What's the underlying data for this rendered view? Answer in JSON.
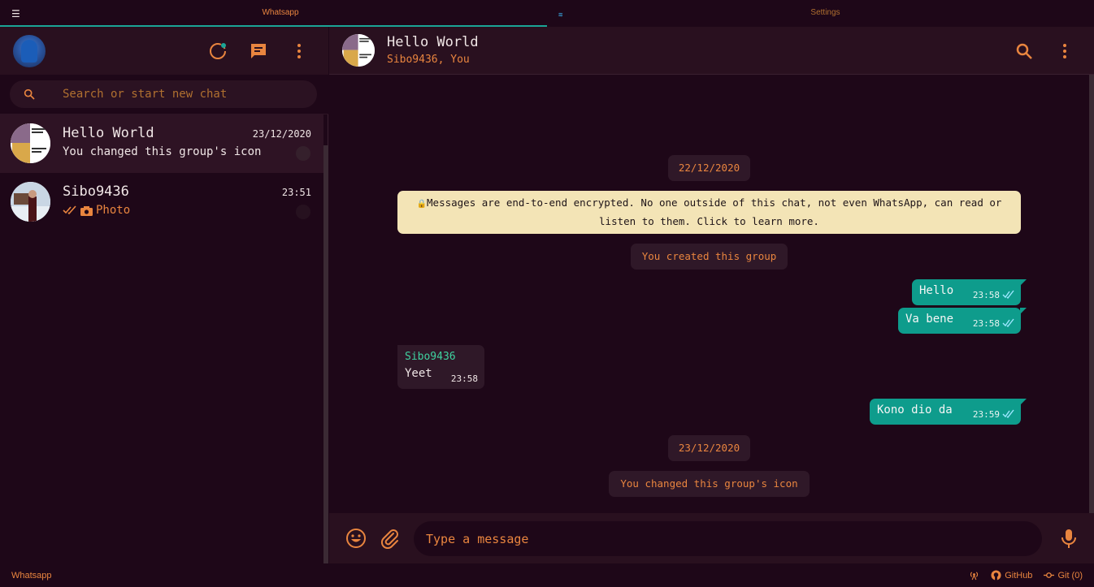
{
  "tabs": {
    "whatsapp": "Whatsapp",
    "settings": "Settings"
  },
  "sidebar": {
    "search_placeholder": "Search or start new chat",
    "chats": [
      {
        "name": "Hello World",
        "time": "23/12/2020",
        "preview": "You changed this group's icon"
      },
      {
        "name": "Sibo9436",
        "time": "23:51",
        "preview": "Photo"
      }
    ]
  },
  "conversation": {
    "title": "Hello World",
    "subtitle": "Sibo9436, You",
    "date1": "22/12/2020",
    "encryption_notice": "Messages are end-to-end encrypted. No one outside of this chat, not even WhatsApp, can read or listen to them. Click to learn more.",
    "system1": "You created this group",
    "messages_out": [
      {
        "text": "Hello",
        "time": "23:58"
      },
      {
        "text": "Va bene",
        "time": "23:58"
      },
      {
        "text": "Kono dio da",
        "time": "23:59"
      }
    ],
    "message_in": {
      "sender": "Sibo9436",
      "text": "Yeet",
      "time": "23:58"
    },
    "date2": "23/12/2020",
    "system2": "You changed this group's icon",
    "input_placeholder": "Type a message"
  },
  "statusbar": {
    "left": "Whatsapp",
    "github": "GitHub",
    "git": "Git (0)"
  },
  "colors": {
    "accent": "#e9853f",
    "teal": "#0e9c8c",
    "background": "#1e0718",
    "panel": "#29101f",
    "notice": "#f3e4b6"
  },
  "icons": [
    "menu-icon",
    "status-icon",
    "new-chat-icon",
    "kebab-icon",
    "search-icon",
    "emoji-icon",
    "attach-icon",
    "mic-icon",
    "double-check-icon",
    "camera-icon",
    "broadcast-icon",
    "github-icon",
    "git-commit-icon"
  ]
}
